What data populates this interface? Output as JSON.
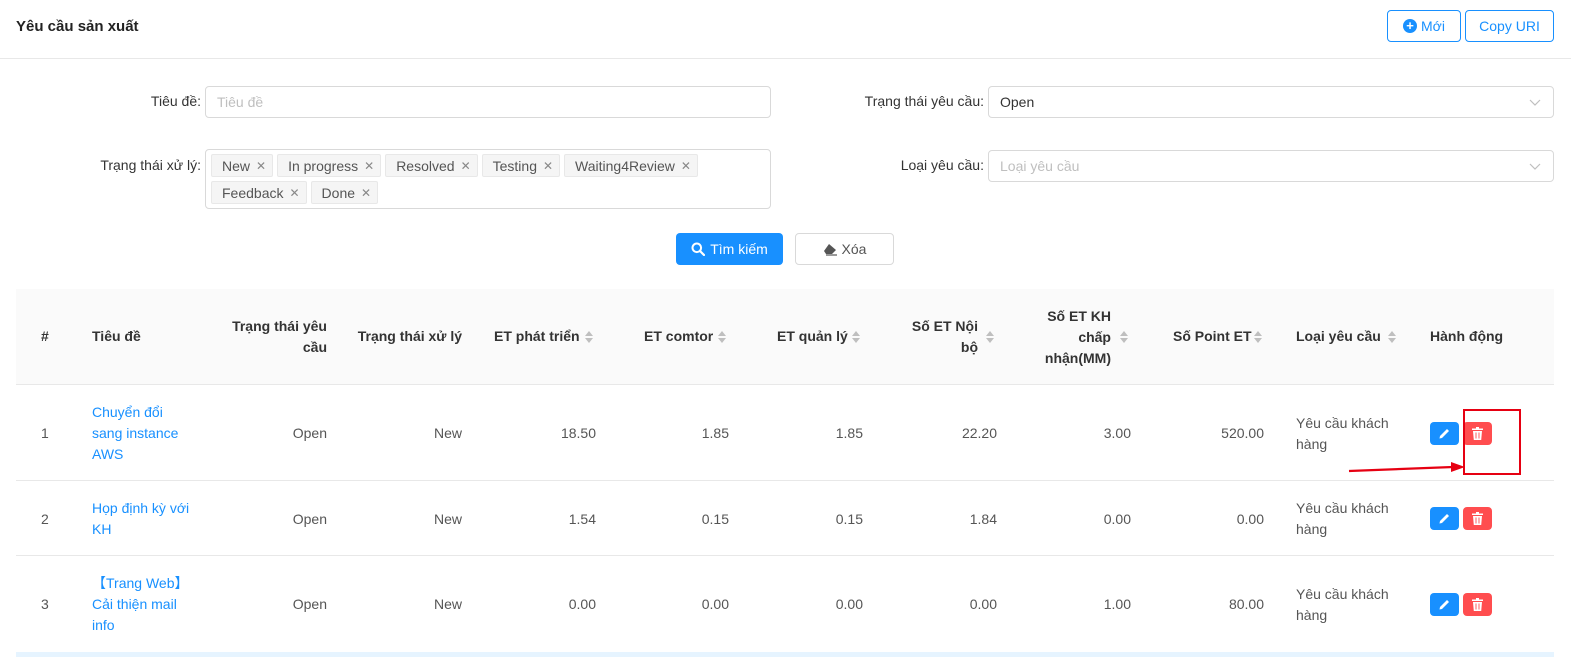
{
  "header": {
    "title": "Yêu cầu sản xuất",
    "new_label": "Mới",
    "copy_label": "Copy URI"
  },
  "filters": {
    "title_label": "Tiêu đề:",
    "title_placeholder": "Tiêu đề",
    "request_status_label": "Trạng thái yêu cầu:",
    "request_status_value": "Open",
    "process_status_label": "Trạng thái xử lý:",
    "process_status_tags": [
      "New",
      "In progress",
      "Resolved",
      "Testing",
      "Waiting4Review",
      "Feedback",
      "Done"
    ],
    "request_type_label": "Loại yêu cầu:",
    "request_type_placeholder": "Loại yêu cầu",
    "search_label": "Tìm kiếm",
    "clear_label": "Xóa"
  },
  "table": {
    "headers": {
      "index": "#",
      "title": "Tiêu đề",
      "request_status": "Trạng thái yêu cầu",
      "process_status": "Trạng thái xử lý",
      "et_dev": "ET phát triển",
      "et_comtor": "ET comtor",
      "et_manage": "ET quản lý",
      "et_internal": "Số ET Nội bộ",
      "et_customer": "Số ET KH chấp nhận(MM)",
      "point_et": "Số Point ET",
      "request_type": "Loại yêu cầu",
      "actions": "Hành động"
    },
    "rows": [
      {
        "index": "1",
        "title": "Chuyển đổi sang instance AWS",
        "request_status": "Open",
        "process_status": "New",
        "et_dev": "18.50",
        "et_comtor": "1.85",
        "et_manage": "1.85",
        "et_internal": "22.20",
        "et_customer": "3.00",
        "point_et": "520.00",
        "request_type": "Yêu cầu khách hàng"
      },
      {
        "index": "2",
        "title": "Họp định kỳ với KH",
        "request_status": "Open",
        "process_status": "New",
        "et_dev": "1.54",
        "et_comtor": "0.15",
        "et_manage": "0.15",
        "et_internal": "1.84",
        "et_customer": "0.00",
        "point_et": "0.00",
        "request_type": "Yêu cầu khách hàng"
      },
      {
        "index": "3",
        "title": "【Trang Web】 Cải thiện mail info",
        "request_status": "Open",
        "process_status": "New",
        "et_dev": "0.00",
        "et_comtor": "0.00",
        "et_manage": "0.00",
        "et_internal": "0.00",
        "et_customer": "1.00",
        "point_et": "80.00",
        "request_type": "Yêu cầu khách hàng"
      }
    ]
  },
  "colors": {
    "primary": "#1890ff",
    "danger": "#ff4d4f",
    "annotation": "#e60012"
  }
}
